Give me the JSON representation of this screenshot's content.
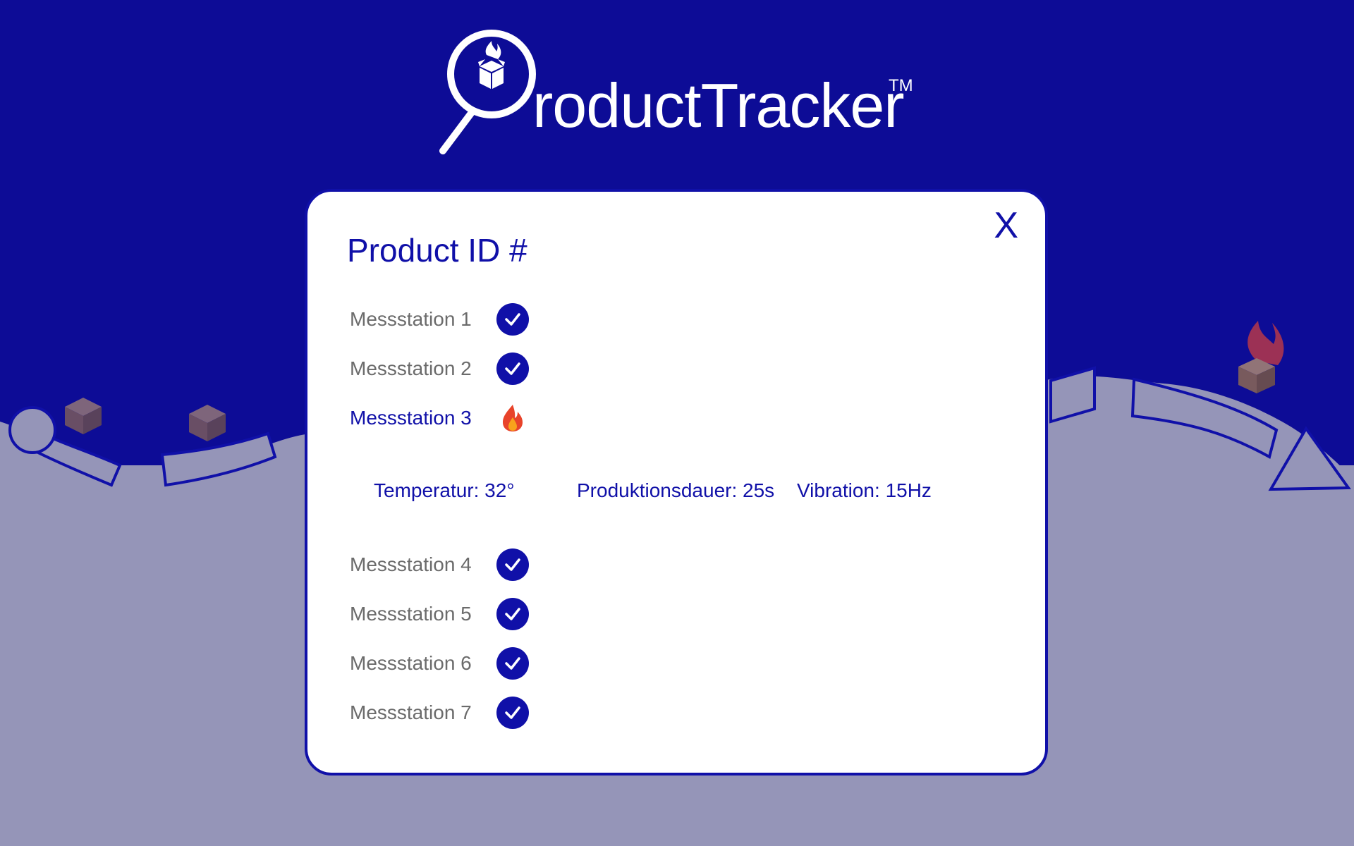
{
  "app": {
    "logo_text": "roductTracker",
    "logo_tm": "TM"
  },
  "modal": {
    "title": "Product ID #",
    "close_label": "X",
    "stations": [
      {
        "label": "Messstation 1",
        "status": "ok",
        "status_icon": "check-icon"
      },
      {
        "label": "Messstation 2",
        "status": "ok",
        "status_icon": "check-icon"
      },
      {
        "label": "Messstation 3",
        "status": "alert",
        "status_icon": "flame-icon"
      },
      {
        "label": "Messstation 4",
        "status": "ok",
        "status_icon": "check-icon"
      },
      {
        "label": "Messstation 5",
        "status": "ok",
        "status_icon": "check-icon"
      },
      {
        "label": "Messstation 6",
        "status": "ok",
        "status_icon": "check-icon"
      },
      {
        "label": "Messstation 7",
        "status": "ok",
        "status_icon": "check-icon"
      }
    ],
    "metrics": {
      "temperature": "Temperatur: 32°",
      "duration": "Produktionsdauer: 25s",
      "vibration": "Vibration: 15Hz"
    }
  },
  "colors": {
    "background": "#0d0c96",
    "accent": "#1010a8",
    "ground": "#9595b8",
    "muted_text": "#6b6b6b"
  }
}
